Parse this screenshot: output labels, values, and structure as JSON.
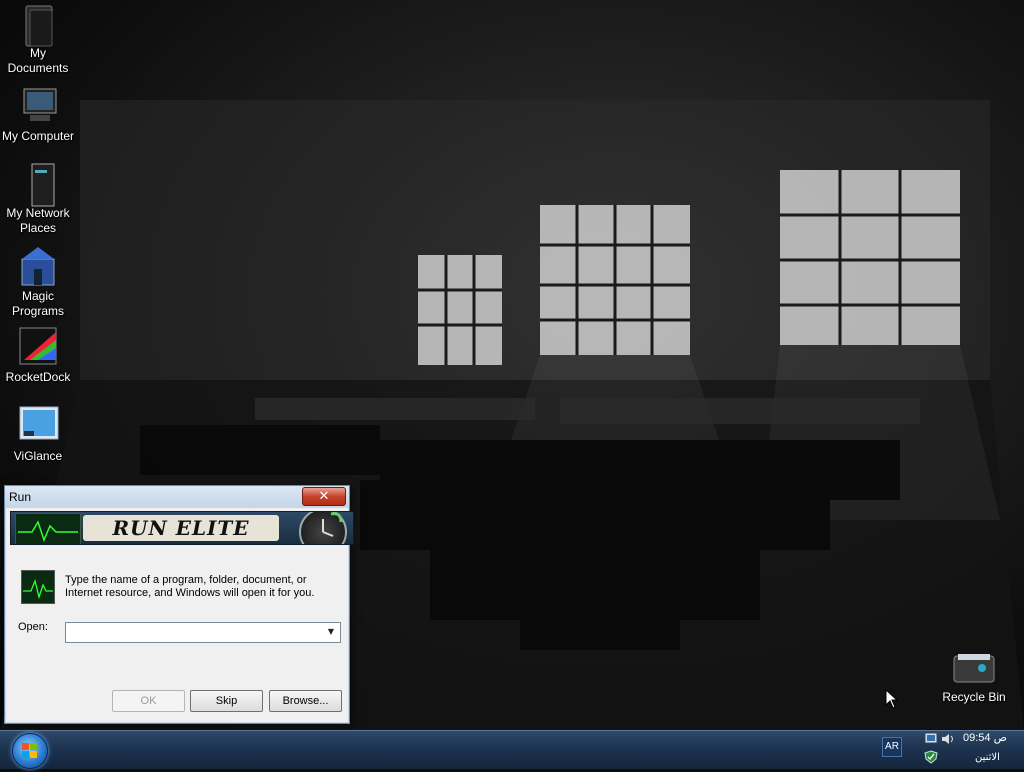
{
  "desktop": {
    "icons": [
      {
        "label": "My Documents",
        "icon": "folder-icon"
      },
      {
        "label": "My Computer",
        "icon": "computer-icon"
      },
      {
        "label": "My Network Places",
        "icon": "network-icon"
      },
      {
        "label": "Magic Programs",
        "icon": "programs-icon"
      },
      {
        "label": "RocketDock",
        "icon": "rocketdock-icon"
      },
      {
        "label": "ViGlance",
        "icon": "viglance-icon"
      }
    ],
    "recycle_bin": {
      "label": "Recycle Bin",
      "icon": "recycle-bin-icon"
    }
  },
  "run_dialog": {
    "title": "Run",
    "banner_text": "RUN ELITE",
    "prompt": "Type the name of a program, folder, document, or Internet resource, and Windows will open it for you.",
    "open_label": "Open:",
    "open_value": "",
    "buttons": {
      "ok": "OK",
      "skip": "Skip",
      "browse": "Browse..."
    }
  },
  "taskbar": {
    "language": "AR",
    "time": "09:54 ص",
    "day": "الاثنين"
  },
  "colors": {
    "taskbar": "#1d3350",
    "close_button": "#c7432a",
    "dialog_bg": "#f0f0f0"
  }
}
